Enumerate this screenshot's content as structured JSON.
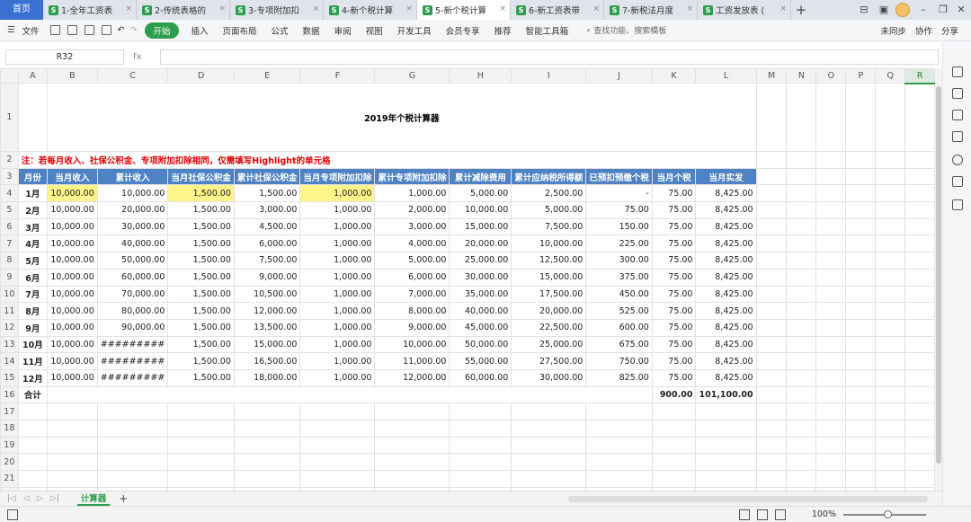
{
  "tabs": {
    "home": "首页",
    "docs": [
      {
        "label": "1-全年工资表",
        "active": false
      },
      {
        "label": "2-传统表格的",
        "active": false
      },
      {
        "label": "3-专项附加扣",
        "active": false
      },
      {
        "label": "4-新个税计算",
        "active": false
      },
      {
        "label": "5-新个税计算",
        "active": true
      },
      {
        "label": "6-新工资表带",
        "active": false
      },
      {
        "label": "7-新税法月度",
        "active": false
      },
      {
        "label": "工资发放表 (",
        "active": false
      }
    ]
  },
  "menu": {
    "file": "文件",
    "start": "开始",
    "items": [
      "插入",
      "页面布局",
      "公式",
      "数据",
      "审阅",
      "视图",
      "开发工具",
      "会员专享",
      "推荐",
      "智能工具箱"
    ],
    "search": "查找功能、搜索模板",
    "right": [
      "未同步",
      "协作",
      "分享"
    ]
  },
  "namebox": "R32",
  "fx": "fx",
  "columns": [
    "A",
    "B",
    "C",
    "D",
    "E",
    "F",
    "G",
    "H",
    "I",
    "J",
    "K",
    "L",
    "M",
    "N",
    "O",
    "P",
    "Q",
    "R"
  ],
  "title": "2019年个税计算器",
  "note": "注：若每月收入、社保公积金、专项附加扣除相同，仅需填写Highlight的单元格",
  "headers": [
    "月份",
    "当月收入",
    "累计收入",
    "当月社保公积金",
    "累计社保公积金",
    "当月专项附加扣除",
    "累计专项附加扣除",
    "累计减除费用",
    "累计应纳税所得额",
    "已预扣预缴个税",
    "当月个税",
    "当月实发"
  ],
  "rows": [
    [
      "1月",
      "10,000.00",
      "10,000.00",
      "1,500.00",
      "1,500.00",
      "1,000.00",
      "1,000.00",
      "5,000.00",
      "2,500.00",
      "-",
      "75.00",
      "8,425.00"
    ],
    [
      "2月",
      "10,000.00",
      "20,000.00",
      "1,500.00",
      "3,000.00",
      "1,000.00",
      "2,000.00",
      "10,000.00",
      "5,000.00",
      "75.00",
      "75.00",
      "8,425.00"
    ],
    [
      "3月",
      "10,000.00",
      "30,000.00",
      "1,500.00",
      "4,500.00",
      "1,000.00",
      "3,000.00",
      "15,000.00",
      "7,500.00",
      "150.00",
      "75.00",
      "8,425.00"
    ],
    [
      "4月",
      "10,000.00",
      "40,000.00",
      "1,500.00",
      "6,000.00",
      "1,000.00",
      "4,000.00",
      "20,000.00",
      "10,000.00",
      "225.00",
      "75.00",
      "8,425.00"
    ],
    [
      "5月",
      "10,000.00",
      "50,000.00",
      "1,500.00",
      "7,500.00",
      "1,000.00",
      "5,000.00",
      "25,000.00",
      "12,500.00",
      "300.00",
      "75.00",
      "8,425.00"
    ],
    [
      "6月",
      "10,000.00",
      "60,000.00",
      "1,500.00",
      "9,000.00",
      "1,000.00",
      "6,000.00",
      "30,000.00",
      "15,000.00",
      "375.00",
      "75.00",
      "8,425.00"
    ],
    [
      "7月",
      "10,000.00",
      "70,000.00",
      "1,500.00",
      "10,500.00",
      "1,000.00",
      "7,000.00",
      "35,000.00",
      "17,500.00",
      "450.00",
      "75.00",
      "8,425.00"
    ],
    [
      "8月",
      "10,000.00",
      "80,000.00",
      "1,500.00",
      "12,000.00",
      "1,000.00",
      "8,000.00",
      "40,000.00",
      "20,000.00",
      "525.00",
      "75.00",
      "8,425.00"
    ],
    [
      "9月",
      "10,000.00",
      "90,000.00",
      "1,500.00",
      "13,500.00",
      "1,000.00",
      "9,000.00",
      "45,000.00",
      "22,500.00",
      "600.00",
      "75.00",
      "8,425.00"
    ],
    [
      "10月",
      "10,000.00",
      "#########",
      "1,500.00",
      "15,000.00",
      "1,000.00",
      "10,000.00",
      "50,000.00",
      "25,000.00",
      "675.00",
      "75.00",
      "8,425.00"
    ],
    [
      "11月",
      "10,000.00",
      "#########",
      "1,500.00",
      "16,500.00",
      "1,000.00",
      "11,000.00",
      "55,000.00",
      "27,500.00",
      "750.00",
      "75.00",
      "8,425.00"
    ],
    [
      "12月",
      "10,000.00",
      "#########",
      "1,500.00",
      "18,000.00",
      "1,000.00",
      "12,000.00",
      "60,000.00",
      "30,000.00",
      "825.00",
      "75.00",
      "8,425.00"
    ]
  ],
  "total": {
    "label": "合计",
    "tax": "900.00",
    "net": "101,100.00"
  },
  "sheet_tab": "计算器",
  "zoom": "100%"
}
